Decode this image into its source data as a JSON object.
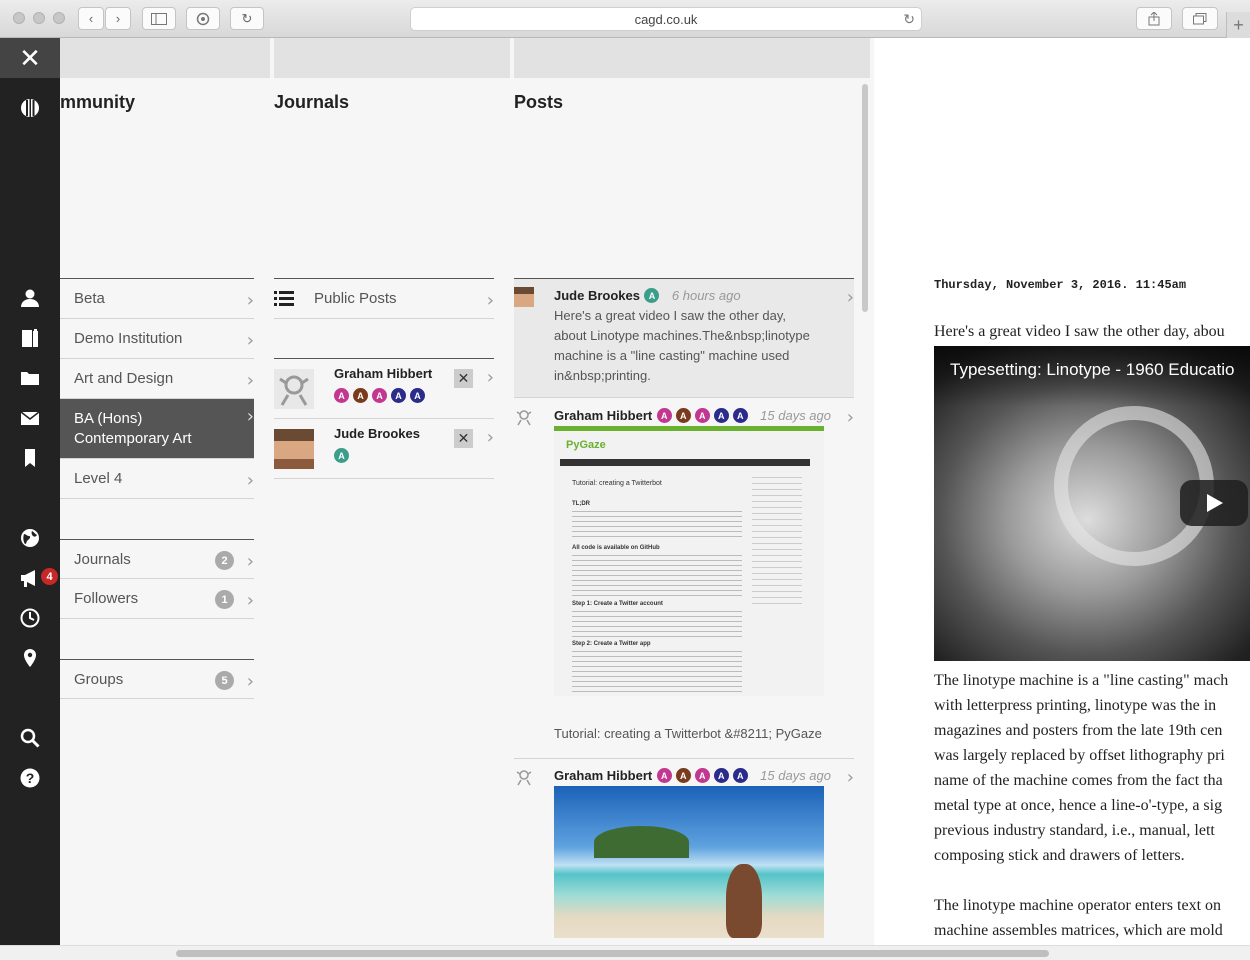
{
  "browser": {
    "url": "cagd.co.uk",
    "nav_close": "✕",
    "newtab": "+"
  },
  "nav": {
    "icons": [
      "logo-icon",
      "user-icon",
      "book-icon",
      "folder-icon",
      "mail-icon",
      "bookmark-icon",
      "globe-icon",
      "megaphone-icon",
      "clock-icon",
      "location-icon",
      "search-icon",
      "help-icon"
    ],
    "notification_count": "4"
  },
  "community": {
    "title": "mmunity",
    "items": [
      {
        "label": "Beta"
      },
      {
        "label": "Demo Institution"
      },
      {
        "label": "Art and Design"
      },
      {
        "label": "BA (Hons) Contemporary Art",
        "line1": "BA (Hons)",
        "line2": "Contemporary Art",
        "selected": true
      },
      {
        "label": "Level 4"
      }
    ],
    "journals": {
      "label": "Journals",
      "count": "2"
    },
    "followers": {
      "label": "Followers",
      "count": "1"
    },
    "groups": {
      "label": "Groups",
      "count": "5"
    }
  },
  "journals": {
    "title": "Journals",
    "public_posts": "Public Posts",
    "people": [
      {
        "name": "Graham Hibbert",
        "badges": [
          "A",
          "A",
          "A",
          "A",
          "A"
        ],
        "badge_colors": [
          "#c2378f",
          "#7a3b1c",
          "#c2378f",
          "#2b2b8c",
          "#2b2b8c"
        ]
      },
      {
        "name": "Jude Brookes",
        "badges": [
          "A"
        ],
        "badge_colors": [
          "#3a9e8a"
        ]
      }
    ],
    "remove_label": "✕"
  },
  "posts": {
    "title": "Posts",
    "items": [
      {
        "author": "Jude Brookes",
        "badges": [
          "A"
        ],
        "badge_colors": [
          "#3a9e8a"
        ],
        "time": "6 hours ago",
        "text_lines": [
          "Here's a great video I saw the other day,",
          "about Linotype machines.The&nbsp;linotype",
          "machine is a \"line casting\" machine used",
          "in&nbsp;printing."
        ]
      },
      {
        "author": "Graham Hibbert",
        "badges": [
          "A",
          "A",
          "A",
          "A",
          "A"
        ],
        "badge_colors": [
          "#c2378f",
          "#7a3b1c",
          "#c2378f",
          "#2b2b8c",
          "#2b2b8c"
        ],
        "time": "15 days ago",
        "thumb": {
          "site": "PyGaze",
          "heading": "Tutorial: creating a Twitterbot",
          "sections": [
            "TL;DR",
            "All code is available on GitHub",
            "Step 1: Create a Twitter account",
            "Step 2: Create a Twitter app"
          ]
        },
        "caption": "Tutorial: creating a Twitterbot &#8211; PyGaze"
      },
      {
        "author": "Graham Hibbert",
        "badges": [
          "A",
          "A",
          "A",
          "A",
          "A"
        ],
        "badge_colors": [
          "#c2378f",
          "#7a3b1c",
          "#c2378f",
          "#2b2b8c",
          "#2b2b8c"
        ],
        "time": "15 days ago"
      }
    ]
  },
  "article": {
    "date": "Thursday, November 3, 2016. 11:45am",
    "intro": "Here's a great video I saw the other day, abou",
    "video_title": "Typesetting: Linotype - 1960 Educatio",
    "para1": [
      "The linotype machine is a \"line casting\" mach",
      "with letterpress printing, linotype was the in",
      "magazines and posters from the late 19th cen",
      "was largely replaced by offset lithography pri",
      "name of the machine comes from the fact tha",
      "metal type at once, hence a line-o'-type, a sig",
      "previous industry standard, i.e., manual, lett",
      "composing stick and drawers of letters."
    ],
    "para2": [
      "The linotype machine operator enters text on",
      "machine assembles matrices, which are mold"
    ]
  }
}
